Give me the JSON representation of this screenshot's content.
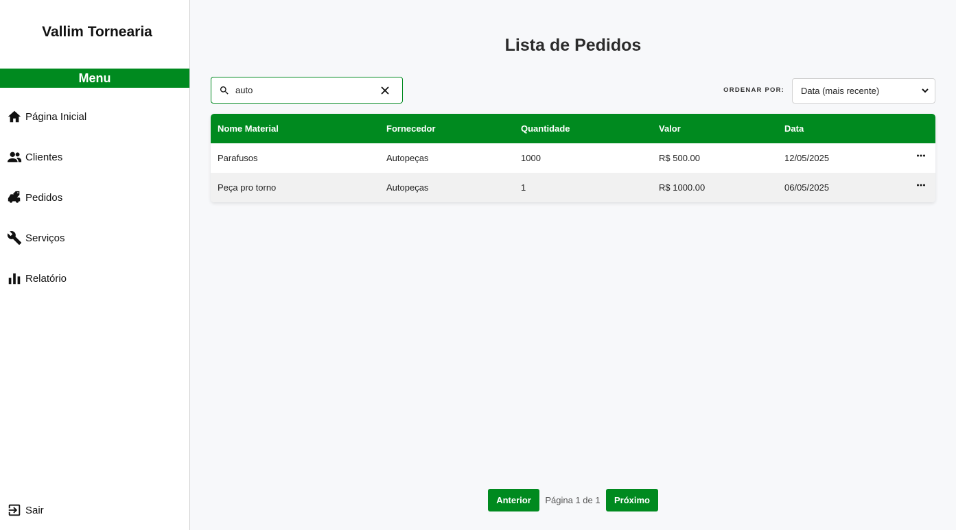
{
  "app": {
    "brand": "Vallim Tornearia",
    "menu_title": "Menu"
  },
  "sidebar": {
    "items": [
      {
        "label": "Página Inicial",
        "icon": "home-icon"
      },
      {
        "label": "Clientes",
        "icon": "users-icon"
      },
      {
        "label": "Pedidos",
        "icon": "orders-icon"
      },
      {
        "label": "Serviços",
        "icon": "wrench-icon"
      },
      {
        "label": "Relatório",
        "icon": "bar-chart-icon"
      }
    ],
    "logout": {
      "label": "Sair",
      "icon": "logout-icon"
    }
  },
  "main": {
    "title": "Lista de Pedidos",
    "search": {
      "value": "auto",
      "icon": "search-icon"
    },
    "sort": {
      "label": "ORDENAR POR:",
      "selected": "Data (mais recente)"
    },
    "table": {
      "headers": [
        "Nome Material",
        "Fornecedor",
        "Quantidade",
        "Valor",
        "Data"
      ],
      "rows": [
        [
          "Parafusos",
          "Autopeças",
          "1000",
          "R$ 500.00",
          "12/05/2025"
        ],
        [
          "Peça pro torno",
          "Autopeças",
          "1",
          "R$ 1000.00",
          "06/05/2025"
        ]
      ]
    },
    "pagination": {
      "prev": "Anterior",
      "info": "Página 1 de 1",
      "next": "Próximo"
    }
  },
  "colors": {
    "accent": "#008a1f",
    "background": "#f7f8fa",
    "sidebar": "#ffffff"
  }
}
